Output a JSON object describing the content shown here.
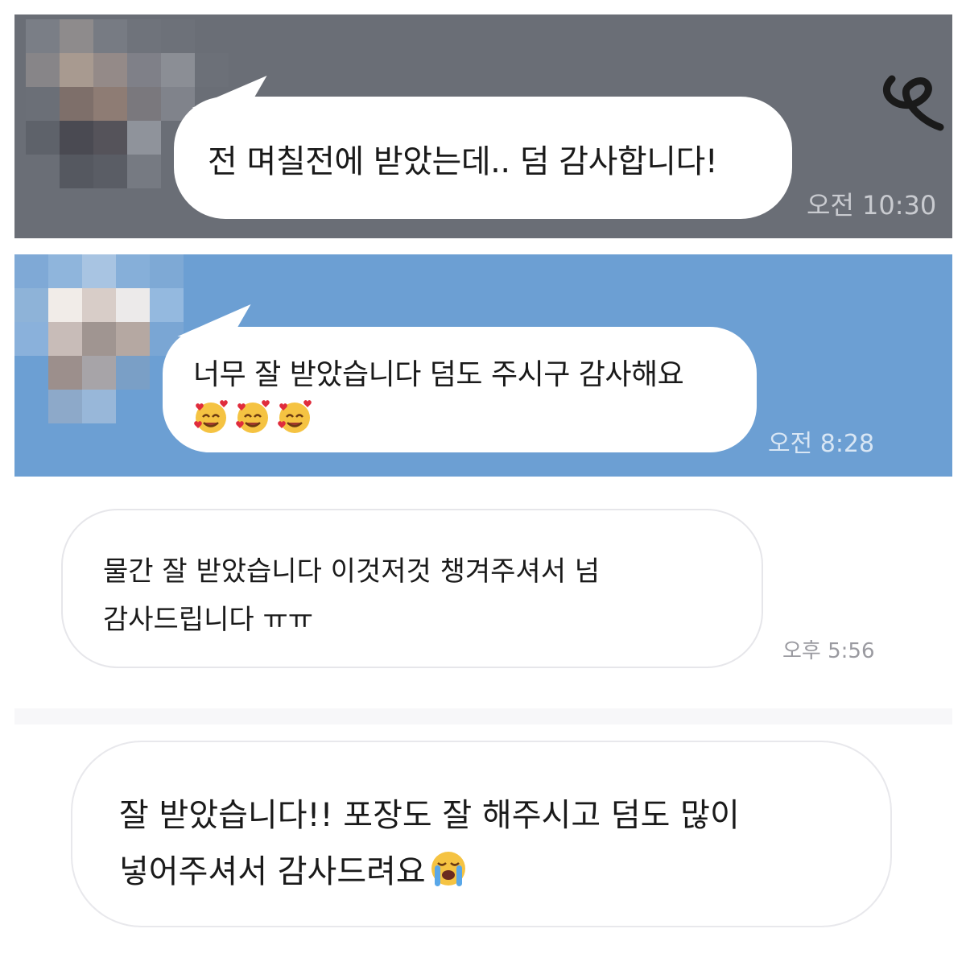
{
  "colors": {
    "panel_1_bg": "#6a6e76",
    "panel_2_bg": "#6c9fd3",
    "panel_3_bg": "#ffffff",
    "panel_4_bg": "#ffffff",
    "bubble_bg": "#ffffff",
    "text": "#1a1a1a"
  },
  "chats": [
    {
      "message_lines": [
        "전 며칠전에 받았는데.. 덤 감사합니다!"
      ],
      "time": "오전 10:30",
      "avatar": "blurred-avatar",
      "decoration": "doodle-icon"
    },
    {
      "message_lines": [
        "너무 잘 받았습니다 덤도 주시구 감사해요"
      ],
      "emojis": [
        "smiling-face-with-hearts-icon",
        "smiling-face-with-hearts-icon",
        "smiling-face-with-hearts-icon"
      ],
      "time": "오전 8:28",
      "avatar": "blurred-avatar"
    },
    {
      "message_lines": [
        "물간 잘 받았습니다 이것저것 챙겨주셔서 넘",
        "감사드립니다 ㅠㅠ"
      ],
      "time": "오후 5:56"
    },
    {
      "message_lines": [
        "잘 받았습니다!! 포장도 잘 해주시고 덤도 많이",
        "넣어주셔서 감사드려요"
      ],
      "emojis": [
        "loudly-crying-face-icon"
      ]
    }
  ]
}
